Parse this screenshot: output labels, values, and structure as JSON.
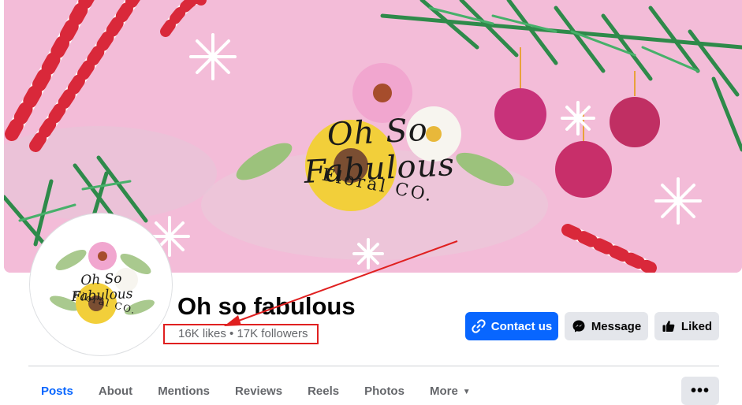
{
  "cover": {
    "logo_text": "Oh So Fabulous",
    "logo_subtext": "Floral CO."
  },
  "avatar": {
    "logo_text": "Oh So Fabulous",
    "logo_subtext": "Floral CO."
  },
  "page": {
    "name": "Oh so fabulous",
    "stats": "16K likes • 17K followers"
  },
  "actions": {
    "contact_label": "Contact us",
    "contact_icon": "link-icon",
    "message_label": "Message",
    "message_icon": "messenger-icon",
    "liked_label": "Liked",
    "liked_icon": "thumbs-up-icon"
  },
  "tabs": [
    {
      "label": "Posts",
      "active": true
    },
    {
      "label": "About"
    },
    {
      "label": "Mentions"
    },
    {
      "label": "Reviews"
    },
    {
      "label": "Reels"
    },
    {
      "label": "Photos"
    },
    {
      "label": "More"
    }
  ],
  "more_button_label": "•••",
  "colors": {
    "primary": "#0866ff",
    "secondary_button": "#e4e6eb",
    "cover_background": "#f3bcd8",
    "annotation": "#e02020"
  }
}
